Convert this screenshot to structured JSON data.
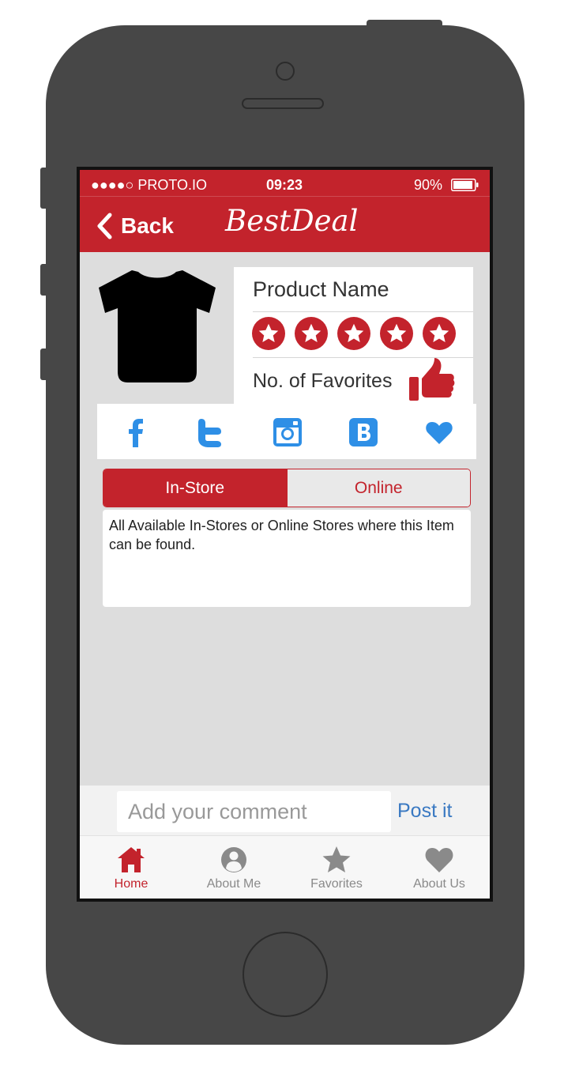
{
  "status_bar": {
    "carrier": "●●●●○ PROTO.IO",
    "time": "09:23",
    "battery": "90%"
  },
  "header": {
    "back_label": "Back",
    "logo": "BestDeal"
  },
  "product": {
    "name": "Product Name",
    "rating_stars": 5,
    "favorites_label": "No. of Favorites"
  },
  "social": [
    "facebook-icon",
    "twitter-icon",
    "instagram-icon",
    "vk-icon",
    "heart-icon"
  ],
  "segmented": {
    "in_store": "In-Store",
    "online": "Online",
    "selected": "In-Store"
  },
  "description": " All Available In-Stores or Online Stores where this Item can be found.",
  "comment": {
    "placeholder": "Add your comment",
    "post_label": "Post it"
  },
  "tabs": [
    {
      "label": "Home",
      "icon": "home-icon",
      "active": true
    },
    {
      "label": "About Me",
      "icon": "user-icon",
      "active": false
    },
    {
      "label": "Favorites",
      "icon": "star-icon",
      "active": false
    },
    {
      "label": "About Us",
      "icon": "heart-icon",
      "active": false
    }
  ],
  "colors": {
    "accent": "#c3232c",
    "link": "#3a79c2",
    "social_blue": "#2e8fe6",
    "device": "#474747"
  }
}
